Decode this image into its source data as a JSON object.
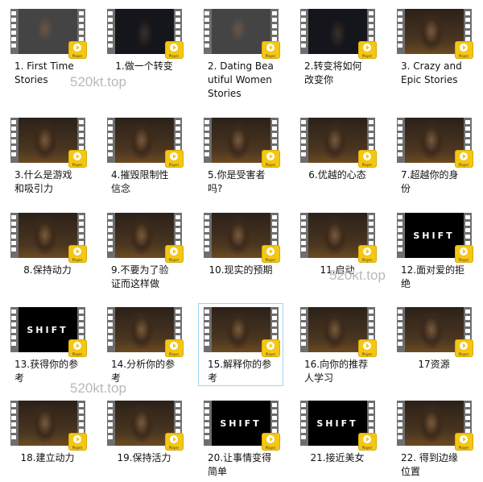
{
  "badge_text": "Player",
  "watermark": "520kt.top",
  "selected_index": 17,
  "items": [
    {
      "label": "1. First Time Stories",
      "thumb": "couch"
    },
    {
      "label": "1.做一个转变",
      "thumb": "city"
    },
    {
      "label": "2. Dating Beautiful Women Stories",
      "thumb": "couch"
    },
    {
      "label": "2.转变将如何改变你",
      "thumb": "city"
    },
    {
      "label": "3. Crazy and Epic Stories",
      "thumb": "person"
    },
    {
      "label": "3.什么是游戏和吸引力",
      "thumb": "person"
    },
    {
      "label": "4.摧毁限制性信念",
      "thumb": "person"
    },
    {
      "label": "5.你是受害者吗?",
      "thumb": "person"
    },
    {
      "label": "6.优越的心态",
      "thumb": "person"
    },
    {
      "label": "7.超越你的身份",
      "thumb": "person"
    },
    {
      "label": "8.保持动力",
      "thumb": "person"
    },
    {
      "label": "9.不要为了验证而这样做",
      "thumb": "person"
    },
    {
      "label": "10.现实的预期",
      "thumb": "person"
    },
    {
      "label": "11.启动",
      "thumb": "person"
    },
    {
      "label": "12.面对爱的拒绝",
      "thumb": "shift",
      "shift_text": "SHIFT"
    },
    {
      "label": "13.获得你的参考",
      "thumb": "shift",
      "shift_text": "SHIFT"
    },
    {
      "label": "14.分析你的参考",
      "thumb": "person"
    },
    {
      "label": "15.解释你的参考",
      "thumb": "person"
    },
    {
      "label": "16.向你的推荐人学习",
      "thumb": "person"
    },
    {
      "label": "17资源",
      "thumb": "person"
    },
    {
      "label": "18.建立动力",
      "thumb": "person"
    },
    {
      "label": "19.保持活力",
      "thumb": "person"
    },
    {
      "label": "20.让事情变得简单",
      "thumb": "shift",
      "shift_text": "SHIFT"
    },
    {
      "label": "21.接近美女",
      "thumb": "shift",
      "shift_text": "SHIFT"
    },
    {
      "label": "22. 得到边缘位置",
      "thumb": "person"
    }
  ]
}
